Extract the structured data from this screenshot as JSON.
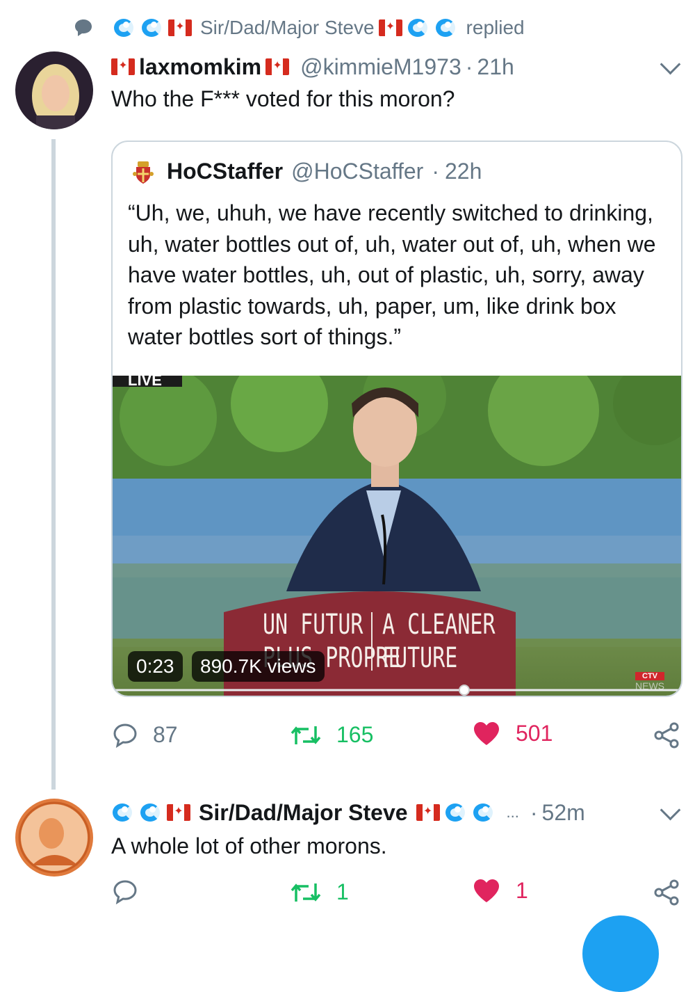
{
  "context": {
    "name": "Sir/Dad/Major Steve",
    "action": "replied"
  },
  "tweet1": {
    "display_name": "laxmomkim",
    "handle": "@kimmieM1973",
    "time": "21h",
    "text": "Who the F*** voted for this moron?"
  },
  "quoted": {
    "display_name": "HoCStaffer",
    "handle": "@HoCStaffer",
    "time": "22h",
    "text": "“Uh, we, uhuh, we have recently switched to drinking, uh, water bottles out of, uh, water out of, uh, when we have water bottles, uh, out of plastic, uh, sorry, away from plastic towards, uh, paper, um, like drink box water bottles sort of things.”",
    "video": {
      "live_label": "LIVE",
      "duration": "0:23",
      "views": "890.7K views",
      "podium_left_line1": "UN FUTUR",
      "podium_left_line2": "PLUS PROPRE",
      "podium_right_line1": "A CLEANER",
      "podium_right_line2": "FUTURE",
      "network": "CTV",
      "network_sub": "NEWS"
    }
  },
  "tweet1_actions": {
    "replies": "87",
    "retweets": "165",
    "likes": "501"
  },
  "tweet2": {
    "display_name": "Sir/Dad/Major Steve",
    "ellipsis": "...",
    "time": "52m",
    "text": "A whole lot of other morons."
  },
  "tweet2_actions": {
    "replies": "",
    "retweets": "1",
    "likes": "1"
  },
  "colors": {
    "retweet": "#17bf63",
    "like": "#e0245e",
    "muted": "#657786",
    "link": "#1da1f2"
  }
}
